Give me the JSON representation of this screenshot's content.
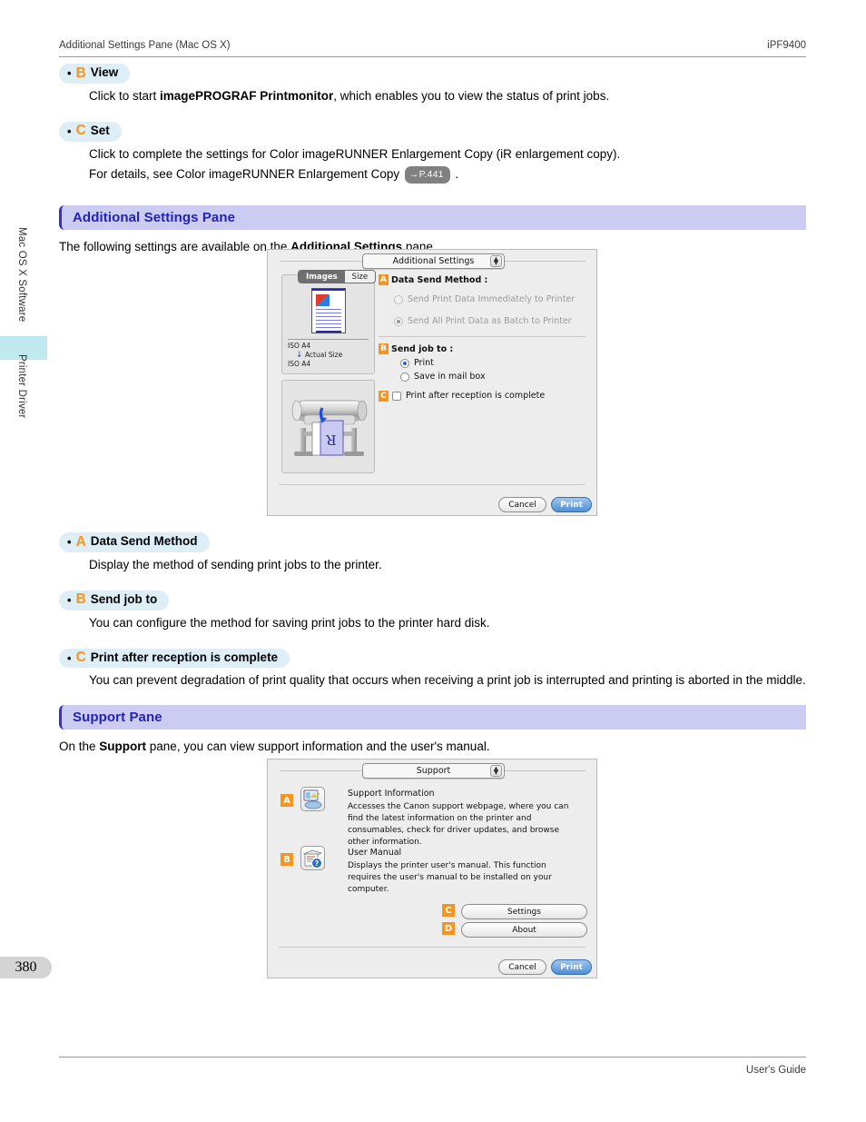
{
  "header": {
    "left": "Additional Settings Pane (Mac OS X)",
    "right": "iPF9400"
  },
  "footer": {
    "right": "User's Guide"
  },
  "sidebar": {
    "tab_software": "Mac OS X Software",
    "tab_driver": "Printer Driver",
    "page_number": "380"
  },
  "top_items": [
    {
      "letter": "B",
      "label": "View",
      "lines": [
        {
          "pre": "Click to start ",
          "bold": "imagePROGRAF Printmonitor",
          "post": ", which enables you to view the status of print jobs."
        }
      ]
    },
    {
      "letter": "C",
      "label": "Set",
      "lines": [
        {
          "pre": "Click to complete the settings for Color imageRUNNER Enlargement Copy (iR enlargement copy).",
          "bold": "",
          "post": ""
        },
        {
          "pre": "For details, see Color imageRUNNER Enlargement Copy ",
          "ref": "→P.441",
          "post": " ."
        }
      ]
    }
  ],
  "section_additional": {
    "heading": "Additional Settings Pane",
    "intro_pre": "The following settings are available on the ",
    "intro_bold": "Additional Settings",
    "intro_post": " pane."
  },
  "dialog_additional": {
    "popup_value": "Additional Settings",
    "segmented": {
      "images": "Images",
      "size": "Size"
    },
    "preview_labels": {
      "paper_top": "ISO A4",
      "scale": "Actual Size",
      "paper_bottom": "ISO A4"
    },
    "tag_a": "A",
    "tag_b": "B",
    "tag_c": "C",
    "group_a_label": "Data Send Method :",
    "option_a1": "Send Print Data Immediately to Printer",
    "option_a2": "Send All Print Data as Batch to Printer",
    "group_b_label": "Send job to :",
    "option_b1": "Print",
    "option_b2": "Save in mail box",
    "option_c1": "Print after reception is complete",
    "cancel": "Cancel",
    "print": "Print"
  },
  "mid_items": [
    {
      "letter": "A",
      "label": "Data Send Method",
      "desc": "Display the method of sending print jobs to the printer."
    },
    {
      "letter": "B",
      "label": "Send job to",
      "desc": "You can configure the method for saving print jobs to the printer hard disk."
    },
    {
      "letter": "C",
      "label": "Print after reception is complete",
      "desc": "You can prevent degradation of print quality that occurs when receiving a print job is interrupted and printing is aborted in the middle."
    }
  ],
  "section_support": {
    "heading": "Support Pane",
    "intro_pre": "On the ",
    "intro_bold": "Support",
    "intro_post": " pane, you can view support information and the user's manual."
  },
  "dialog_support": {
    "popup_value": "Support",
    "tag_a": "A",
    "tag_b": "B",
    "tag_c": "C",
    "tag_d": "D",
    "support_info_title": "Support Information",
    "support_info_desc": "Accesses the Canon support webpage, where you can find the latest information on the printer and consumables, check for driver updates, and browse other information.",
    "user_manual_title": "User Manual",
    "user_manual_desc": "Displays the printer user's manual. This function requires the user's manual to be installed on your computer.",
    "settings_button": "Settings",
    "about_button": "About",
    "cancel": "Cancel",
    "print": "Print"
  },
  "colors": {
    "accent_orange": "#f7941d",
    "heading_blue": "#2222bb",
    "heading_bar_bg": "#ccccf2",
    "pill_bg": "#ddeef7",
    "tab_marker": "#bfe9ef",
    "dialog_bg": "#ededed"
  }
}
